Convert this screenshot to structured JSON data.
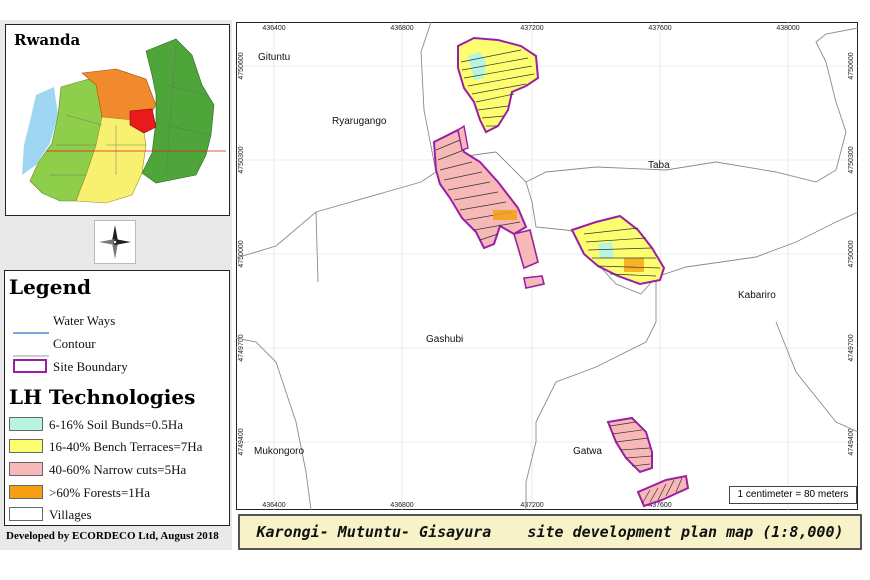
{
  "inset": {
    "title": "Rwanda"
  },
  "legend": {
    "title": "Legend",
    "items": [
      {
        "label": "Water Ways",
        "color": "#4a8ed0"
      },
      {
        "label": "Contour",
        "color": "#999999"
      },
      {
        "label": "Site Boundary",
        "color": "#9b1fa6"
      }
    ],
    "tech_title": "LH Technologies",
    "tech": [
      {
        "label": "6-16% Soil Bunds=0.5Ha",
        "color": "#b8f5e0"
      },
      {
        "label": "16-40% Bench Terraces=7Ha",
        "color": "#fdfd70"
      },
      {
        "label": "40-60% Narrow cuts=5Ha",
        "color": "#f7b8b8"
      },
      {
        "label": ">60% Forests=1Ha",
        "color": "#f5a012"
      },
      {
        "label": "Villages",
        "color": "#ffffff"
      }
    ]
  },
  "credit": "Developed by ECORDECO Ltd, August 2018",
  "map": {
    "x_ticks": [
      "436400",
      "436800",
      "437200",
      "437600",
      "438000"
    ],
    "y_ticks": [
      "4750600",
      "4750300",
      "4750000",
      "4749700",
      "4749400"
    ],
    "places": {
      "gituntu": "Gituntu",
      "ryarugango": "Ryarugango",
      "taba": "Taba",
      "kabariro": "Kabariro",
      "gashubi": "Gashubi",
      "mukongoro": "Mukongoro",
      "gatwa": "Gatwa"
    },
    "scale": "1 centimeter = 80 meters"
  },
  "title": "Karongi- Mutuntu- Gisayura    site development plan map (1:8,000)"
}
